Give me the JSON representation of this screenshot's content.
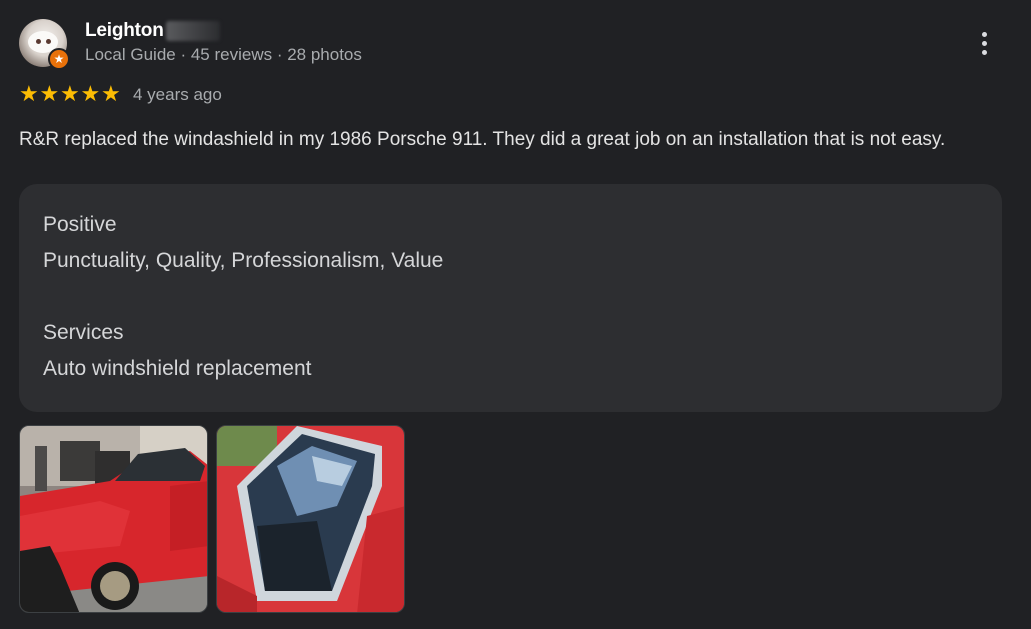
{
  "reviewer": {
    "name": "Leighton",
    "meta": "Local Guide · 45 reviews · 28 photos",
    "avatar_icon": "guinea-pig-avatar",
    "badge_icon": "local-guide-star-icon"
  },
  "menu": {
    "icon": "more-vert-icon"
  },
  "rating": {
    "stars": 5,
    "max": 5,
    "time": "4 years ago",
    "star_color": "#fbbc04"
  },
  "review_text": "R&R replaced the windashield in my 1986 Porsche 911. They did a great job on an installation that is not easy.",
  "attributes": [
    {
      "title": "Positive",
      "value": "Punctuality, Quality, Professionalism, Value"
    },
    {
      "title": "Services",
      "value": "Auto windshield replacement"
    }
  ],
  "photos": [
    {
      "name": "photo-red-porsche-garage"
    },
    {
      "name": "photo-windshield-closeup"
    }
  ],
  "colors": {
    "background": "#202124",
    "card": "#2d2e31",
    "text": "#e3e3e3",
    "muted": "#a8abae",
    "guide_badge": "#e8710a"
  }
}
